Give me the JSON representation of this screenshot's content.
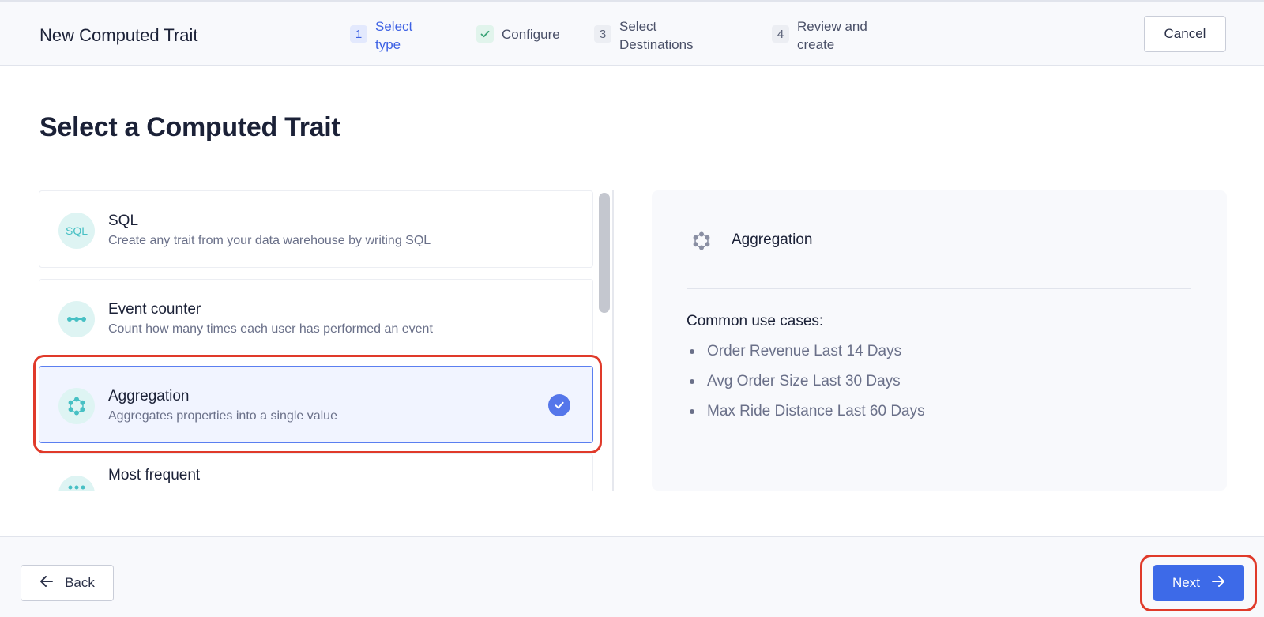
{
  "header": {
    "title": "New Computed Trait",
    "steps": [
      {
        "number": "1",
        "label": "Select type",
        "state": "active"
      },
      {
        "number": "✓",
        "label": "Configure",
        "state": "done"
      },
      {
        "number": "3",
        "label": "Select Destinations",
        "state": "pending"
      },
      {
        "number": "4",
        "label": "Review and create",
        "state": "pending"
      }
    ],
    "cancel_label": "Cancel"
  },
  "main": {
    "title": "Select a Computed Trait",
    "options": [
      {
        "icon": "sql-icon",
        "icon_text": "SQL",
        "title": "SQL",
        "description": "Create any trait from your data warehouse by writing SQL",
        "selected": false
      },
      {
        "icon": "event-counter-icon",
        "title": "Event counter",
        "description": "Count how many times each user has performed an event",
        "selected": false
      },
      {
        "icon": "aggregation-icon",
        "title": "Aggregation",
        "description": "Aggregates properties into a single value",
        "selected": true
      },
      {
        "icon": "most-frequent-icon",
        "title": "Most frequent",
        "description": "",
        "selected": false
      }
    ]
  },
  "detail": {
    "title": "Aggregation",
    "use_cases_heading": "Common use cases:",
    "use_cases": [
      "Order Revenue Last 14 Days",
      "Avg Order Size Last 30 Days",
      "Max Ride Distance Last 60 Days"
    ]
  },
  "footer": {
    "back_label": "Back",
    "next_label": "Next"
  },
  "colors": {
    "accent": "#3d6ae8",
    "highlight": "#e03a2a",
    "icon_teal": "#47c0c4"
  }
}
